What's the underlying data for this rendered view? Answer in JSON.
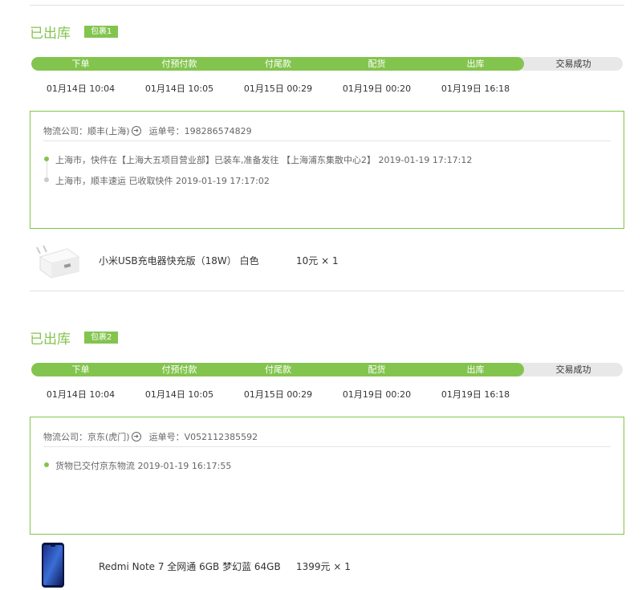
{
  "steps": [
    "下单",
    "付预付款",
    "付尾款",
    "配货",
    "出库",
    "交易成功"
  ],
  "packages": [
    {
      "status": "已出库",
      "badge": "包裹1",
      "times": [
        "01月14日 10:04",
        "01月14日 10:05",
        "01月15日 00:29",
        "01月19日 00:20",
        "01月19日 16:18"
      ],
      "logistics": {
        "company_label": "物流公司：",
        "company": "顺丰(上海)",
        "waybill_label": "运单号：",
        "waybill": "198286574829",
        "tracks": [
          "上海市，快件在【上海大五项目营业部】已装车,准备发往 【上海浦东集散中心2】 2019-01-19 17:17:12",
          "上海市，顺丰速运 已收取快件 2019-01-19 17:17:02"
        ]
      },
      "product": {
        "name": "小米USB充电器快充版（18W） 白色",
        "price": "10元 × 1",
        "image": "white-charger"
      }
    },
    {
      "status": "已出库",
      "badge": "包裹2",
      "times": [
        "01月14日 10:04",
        "01月14日 10:05",
        "01月15日 00:29",
        "01月19日 00:20",
        "01月19日 16:18"
      ],
      "logistics": {
        "company_label": "物流公司：",
        "company": "京东(虎门)",
        "waybill_label": "运单号：",
        "waybill": "V052112385592",
        "tracks": [
          "货物已交付京东物流 2019-01-19 16:17:55"
        ]
      },
      "product": {
        "name": "Redmi Note 7 全网通 6GB 梦幻蓝 64GB",
        "price": "1399元 × 1",
        "image": "blue-phone"
      }
    }
  ],
  "colors": {
    "accent": "#83c44e",
    "track": "#e8e8e8",
    "border": "#83c44e"
  },
  "progress_completed_steps": 5
}
